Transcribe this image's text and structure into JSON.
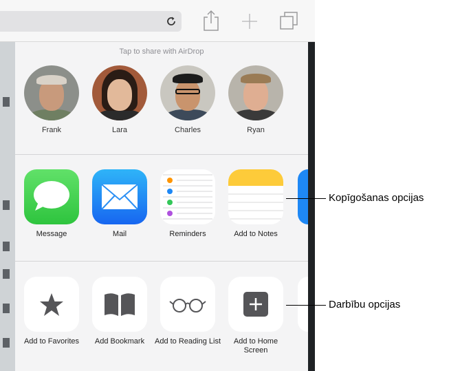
{
  "colors": {
    "toolbar_bg": "#f7f7f7",
    "sheet_bg": "#f4f4f5",
    "messages_green": "#34c759",
    "mail_blue": "#1e88f5",
    "notes_yellow": "#fed33c",
    "icon_gray": "#555558"
  },
  "toolbar": {
    "icons": [
      "reload-icon",
      "share-icon",
      "add-tab-icon",
      "tabs-icon"
    ]
  },
  "airdrop": {
    "title": "Tap to share with AirDrop",
    "people": [
      {
        "name": "Frank"
      },
      {
        "name": "Lara"
      },
      {
        "name": "Charles"
      },
      {
        "name": "Ryan"
      }
    ]
  },
  "share_row": {
    "items": [
      {
        "label": "Message",
        "icon": "message-icon"
      },
      {
        "label": "Mail",
        "icon": "mail-icon"
      },
      {
        "label": "Reminders",
        "icon": "reminders-icon"
      },
      {
        "label": "Add to Notes",
        "icon": "notes-icon"
      }
    ]
  },
  "action_row": {
    "items": [
      {
        "label": "Add to Favorites",
        "icon": "star-icon"
      },
      {
        "label": "Add Bookmark",
        "icon": "bookmark-icon"
      },
      {
        "label": "Add to Reading List",
        "icon": "glasses-icon"
      },
      {
        "label": "Add to Home Screen",
        "icon": "plus-square-icon"
      }
    ]
  },
  "callouts": {
    "share_options": "Kopīgošanas opcijas",
    "action_options": "Darbību opcijas"
  }
}
